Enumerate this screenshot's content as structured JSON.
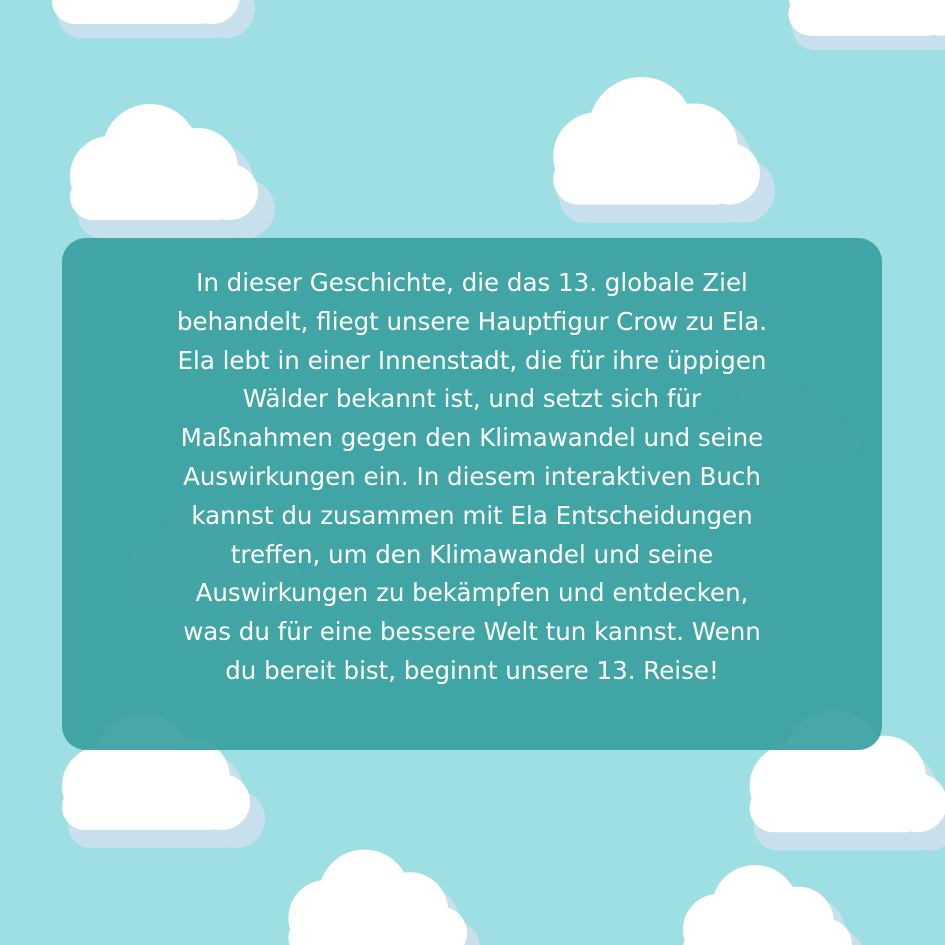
{
  "background_color": "#9ddfe2",
  "panel_color": "#3aa0a0",
  "text_color": "#ffffff",
  "story_lines": [
    "In dieser Geschichte, die das 13. globale Ziel",
    "behandelt, fliegt unsere Hauptfigur Crow zu Ela.",
    "Ela lebt in einer Innenstadt, die für ihre üppigen",
    "Wälder bekannt ist, und setzt sich für",
    "Maßnahmen gegen den Klimawandel und seine",
    "Auswirkungen ein. In diesem interaktiven Buch",
    "kannst du zusammen mit Ela Entscheidungen",
    "treffen, um den Klimawandel und seine",
    "Auswirkungen zu bekämpfen und entdecken,",
    "was du für eine bessere Welt tun kannst. Wenn",
    "du bereit bist, beginnt unsere 13. Reise!"
  ]
}
